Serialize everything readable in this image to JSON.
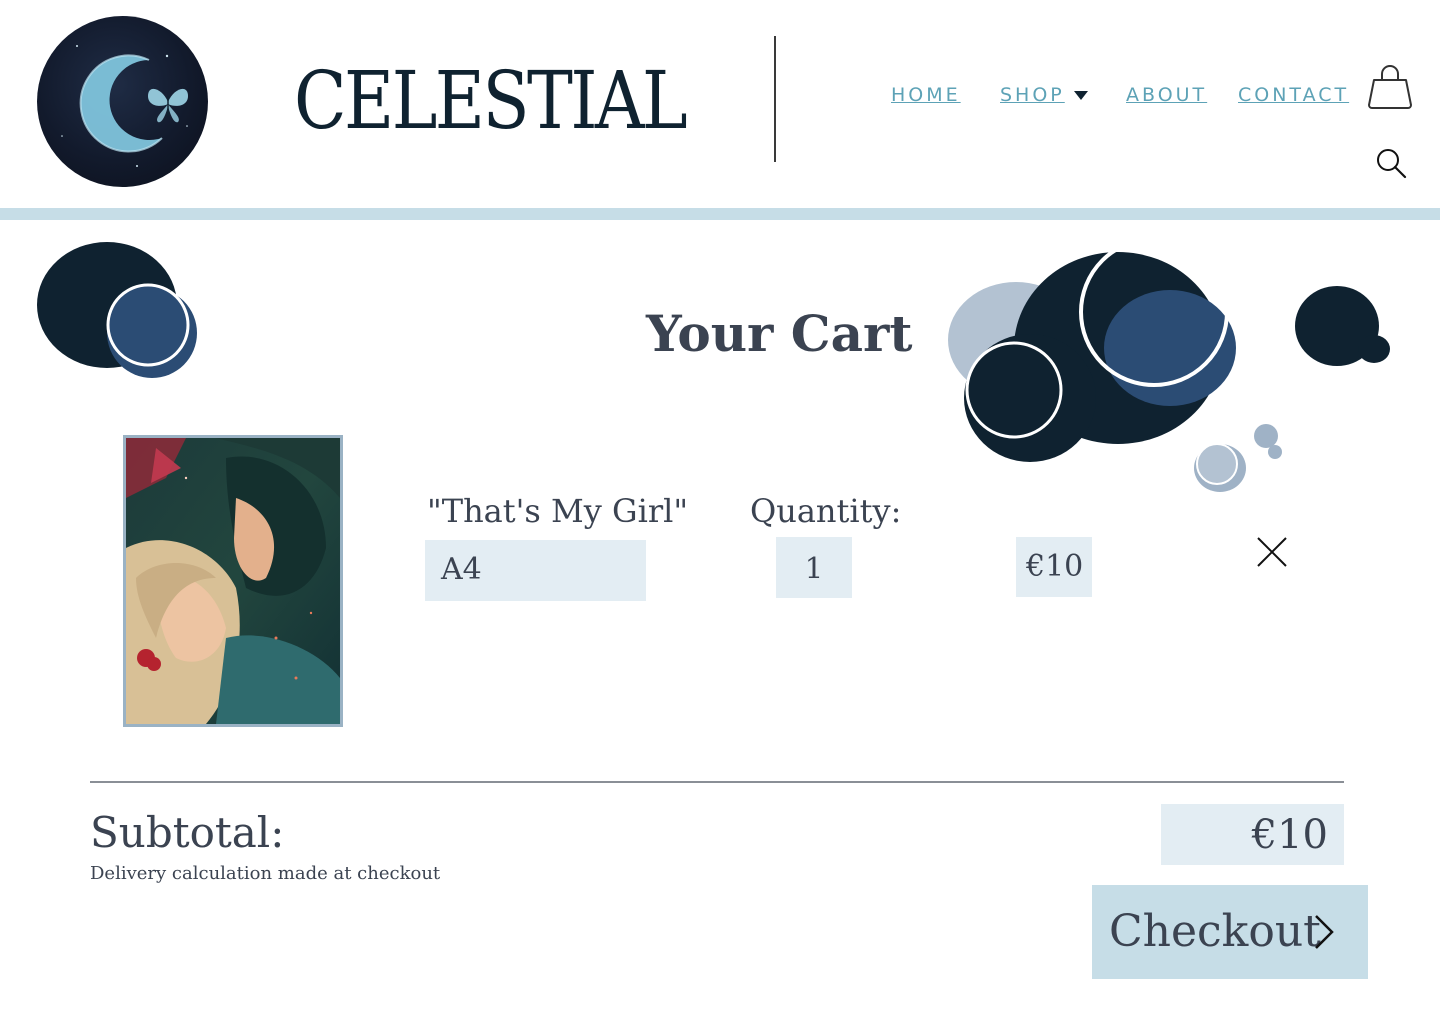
{
  "brand": {
    "name": "CELESTIAL",
    "logo_icon": "moon-butterfly-logo"
  },
  "nav": {
    "home": "HOME",
    "shop": "SHOP",
    "about": "ABOUT",
    "contact": "CONTACT",
    "icons": [
      "shopping-bag-icon",
      "search-icon",
      "chevron-down-icon"
    ]
  },
  "cart": {
    "title": "Your Cart",
    "items": [
      {
        "name": "\"That's My Girl\"",
        "variant": "A4",
        "quantity_label": "Quantity:",
        "quantity": "1",
        "price": "€10"
      }
    ],
    "subtotal_label": "Subtotal:",
    "subtotal_value": "€10",
    "delivery_note": "Delivery calculation made at checkout",
    "checkout_label": "Checkout"
  },
  "colors": {
    "accent": "#5da2b6",
    "navy": "#0f2230",
    "band": "#c6dde7",
    "field_bg": "#e3edf3",
    "text": "#3b4351"
  }
}
